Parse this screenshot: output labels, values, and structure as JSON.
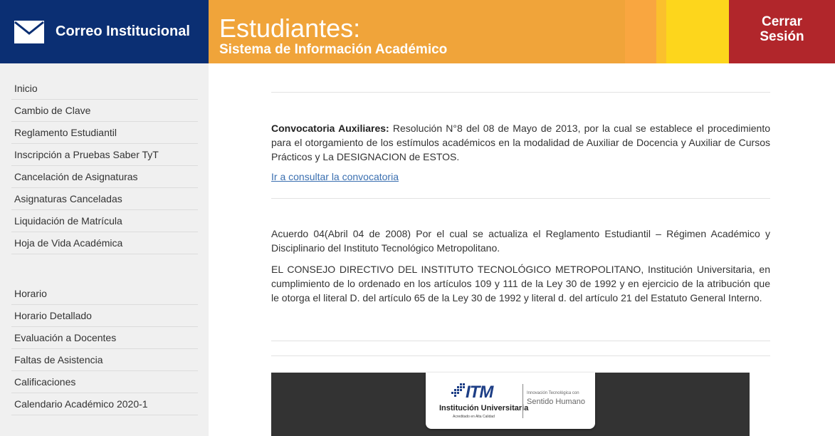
{
  "header": {
    "mail_label": "Correo Institucional",
    "title": "Estudiantes:",
    "subtitle": "Sistema de Información Académico",
    "logout_line1": "Cerrar",
    "logout_line2": "Sesión"
  },
  "colors": {
    "navy": "#0b2f73",
    "orange": "#f0a43a",
    "yellow": "#fdd61c",
    "red": "#b1262b",
    "link": "#3a6fb0"
  },
  "icons": {
    "mail": "envelope-icon"
  },
  "sidebar": {
    "group1": [
      "Inicio",
      "Cambio de Clave",
      "Reglamento Estudiantil",
      "Inscripción a Pruebas Saber TyT",
      "Cancelación de Asignaturas",
      "Asignaturas Canceladas",
      "Liquidación de Matrícula",
      "Hoja de Vida Académica"
    ],
    "group2": [
      "Horario",
      "Horario Detallado",
      "Evaluación a Docentes",
      "Faltas de Asistencia",
      "Calificaciones",
      "Calendario Académico 2020-1"
    ]
  },
  "main": {
    "notice1_title": "Convocatoria Auxiliares:",
    "notice1_text": " Resolución N°8 del 08 de Mayo de 2013, por la cual se establece el procedimiento para el otorgamiento de los estímulos académicos en la modalidad de Auxiliar de Docencia y Auxiliar de Cursos Prácticos y La DESIGNACION de ESTOS.",
    "notice1_link": "Ir a consultar la convocatoria",
    "notice2_p1": "Acuerdo 04(Abril 04 de 2008) Por el cual se actualiza el Reglamento Estudiantil – Régimen Académico y Disciplinario del Instituto Tecnológico Metropolitano.",
    "notice2_p2": "EL CONSEJO DIRECTIVO DEL INSTITUTO TECNOLÓGICO METROPOLITANO, Institución Universitaria, en cumplimiento de lo ordenado en los artículos 109 y 111 de la Ley 30 de 1992 y en ejercicio de la atribución que le otorga el literal D. del artículo 65 de la Ley 30 de 1992 y literal d. del artículo 21 del Estatuto General Interno."
  },
  "banner": {
    "logo_itm": "ITM",
    "logo_institution": "Institución Universitaria",
    "logo_accredited": "Acreditado en Alta Calidad",
    "logo_tagline_small": "Innovación Tecnológica con",
    "logo_tagline_big": "Sentido Humano"
  }
}
